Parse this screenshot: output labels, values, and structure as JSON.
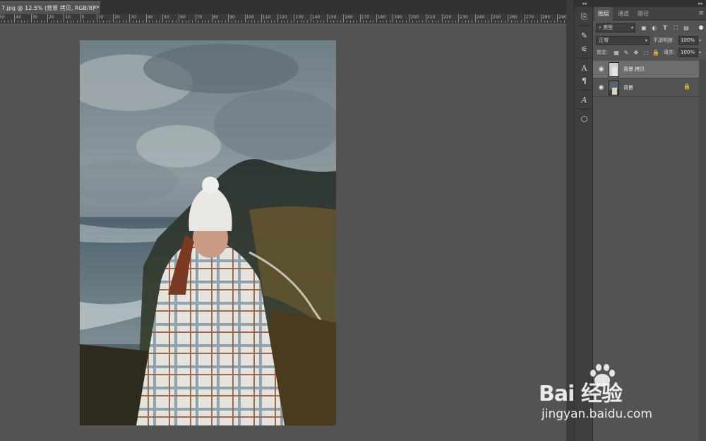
{
  "document_tab": {
    "title": "7.jpg @ 12.5% (背景 拷贝, RGB/8) *",
    "close_glyph": "×"
  },
  "ruler": {
    "labels": [
      "50",
      "40",
      "30",
      "20",
      "10",
      "0",
      "10",
      "20",
      "30",
      "40",
      "50",
      "60",
      "70",
      "80",
      "90",
      "100",
      "110",
      "120",
      "130",
      "140",
      "150",
      "160",
      "170",
      "180",
      "190",
      "200",
      "210",
      "220",
      "230",
      "240",
      "250",
      "260",
      "270",
      "280",
      "290"
    ]
  },
  "tool_strip": {
    "collapse_glyph": "◂◂",
    "icons": [
      "history-icon",
      "brush-settings-icon",
      "adjust-brush-icon",
      "character-icon",
      "paragraph-icon",
      "glyphs-icon",
      "3d-icon"
    ]
  },
  "layers_panel": {
    "collapse_glyph": "▸▸",
    "tabs": [
      "图层",
      "通道",
      "路径"
    ],
    "active_tab": "图层",
    "filter_kind": "类型",
    "blend_mode": "正常",
    "opacity_label": "不透明度:",
    "opacity_value": "100%",
    "lock_label": "锁定:",
    "fill_label": "填充:",
    "fill_value": "100%",
    "layers": [
      {
        "name": "背景 拷贝",
        "visible": true,
        "selected": true,
        "locked": false
      },
      {
        "name": "背景",
        "visible": true,
        "selected": false,
        "locked": true
      }
    ]
  },
  "watermark": {
    "brand": "Bai  经验",
    "url": "jingyan.baidu.com"
  },
  "colors": {
    "app_bg": "#535353",
    "panel_dark": "#323232",
    "selected_layer": "#6d6d6d"
  }
}
